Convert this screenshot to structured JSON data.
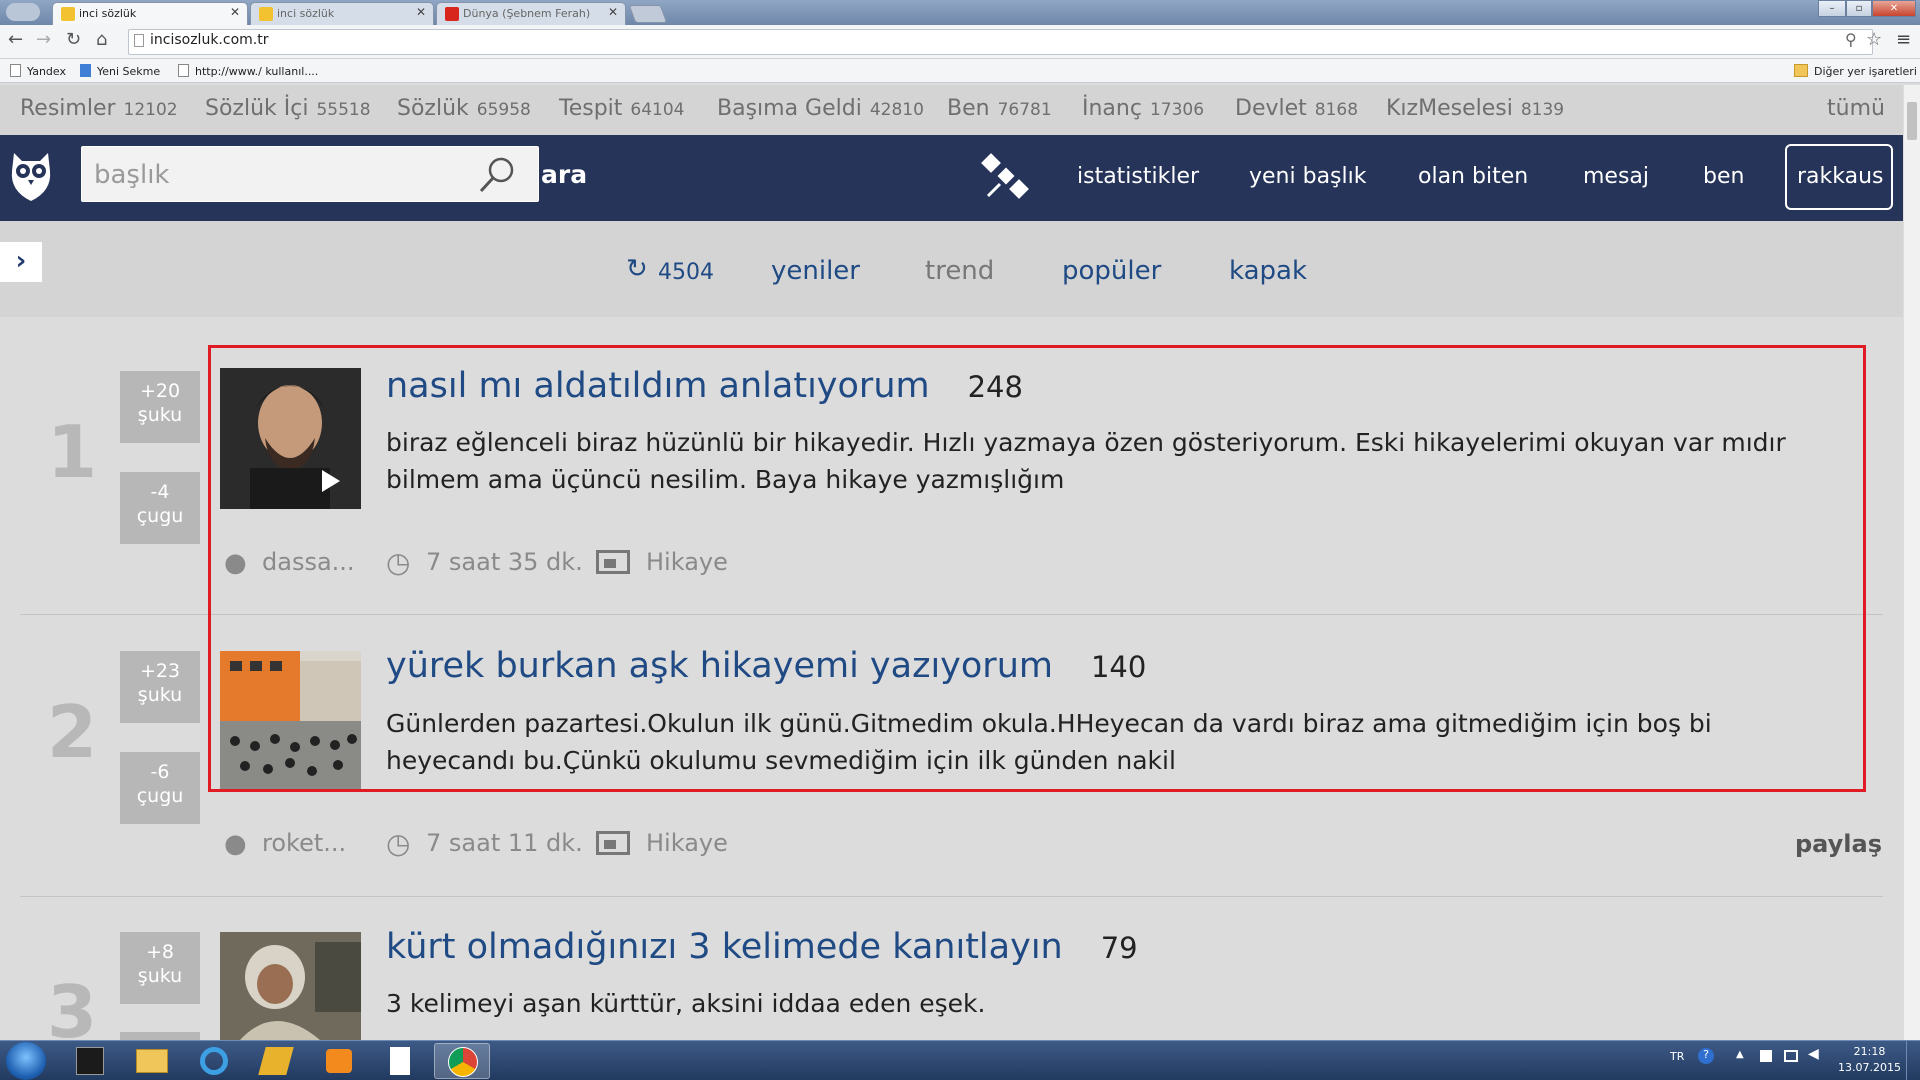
{
  "browser": {
    "tabs": [
      {
        "label": "inci sözlük",
        "active": true
      },
      {
        "label": "inci sözlük",
        "active": false
      },
      {
        "label": "Dünya (Şebnem Ferah)",
        "active": false
      }
    ],
    "url": "incisozluk.com.tr",
    "bookmarks": [
      "Yandex",
      "Yeni Sekme",
      "http://www./ kullanıl...."
    ],
    "other_bookmarks": "Diğer yer işaretleri"
  },
  "categories": [
    {
      "name": "Resimler",
      "count": "12102"
    },
    {
      "name": "Sözlük İçi",
      "count": "55518"
    },
    {
      "name": "Sözlük",
      "count": "65958"
    },
    {
      "name": "Tespit",
      "count": "64104"
    },
    {
      "name": "Başıma Geldi",
      "count": "42810"
    },
    {
      "name": "Ben",
      "count": "76781"
    },
    {
      "name": "İnanç",
      "count": "17306"
    },
    {
      "name": "Devlet",
      "count": "8168"
    },
    {
      "name": "KızMeselesi",
      "count": "8139"
    }
  ],
  "all_label": "tümü",
  "header": {
    "search_placeholder": "başlık",
    "search_button": "ara",
    "nav": [
      "istatistikler",
      "yeni başlık",
      "olan biten",
      "mesaj",
      "ben"
    ],
    "user": "rakkaus"
  },
  "subnav": {
    "refresh_count": "4504",
    "items": [
      "yeniler",
      "trend",
      "popüler",
      "kapak"
    ]
  },
  "posts": [
    {
      "rank": "1",
      "up": "+20",
      "up_label": "şuku",
      "down": "-4",
      "down_label": "çugu",
      "title": "nasıl mı aldatıldım anlatıyorum",
      "count": "248",
      "desc": "biraz eğlenceli biraz hüzünlü bir hikayedir. Hızlı yazmaya özen gösteriyorum. Eski hikayelerimi okuyan var mıdır bilmem ama üçüncü nesilim. Baya hikaye yazmışlığım",
      "author": "dassa...",
      "time": "7 saat 35 dk.",
      "category": "Hikaye"
    },
    {
      "rank": "2",
      "up": "+23",
      "up_label": "şuku",
      "down": "-6",
      "down_label": "çugu",
      "title": "yürek burkan aşk hikayemi yazıyorum",
      "count": "140",
      "desc": "Günlerden pazartesi.Okulun ilk günü.Gitmedim okula.HHeyecan da vardı biraz ama gitmediğim için boş bi heyecandı bu.Çünkü okulumu sevmediğim için ilk günden nakil",
      "author": "roket...",
      "time": "7 saat 11 dk.",
      "category": "Hikaye",
      "share": "paylaş"
    },
    {
      "rank": "3",
      "up": "+8",
      "up_label": "şuku",
      "title": "kürt olmadığınızı 3 kelimede kanıtlayın",
      "count": "79",
      "desc": "3 kelimeyi aşan kürttür, aksini iddaa eden eşek."
    }
  ],
  "taskbar": {
    "lang": "TR",
    "time": "21:18",
    "date": "13.07.2015"
  },
  "colors": {
    "header_bg": "#26345a",
    "link": "#1f4a84",
    "highlight": "#e01b24"
  }
}
